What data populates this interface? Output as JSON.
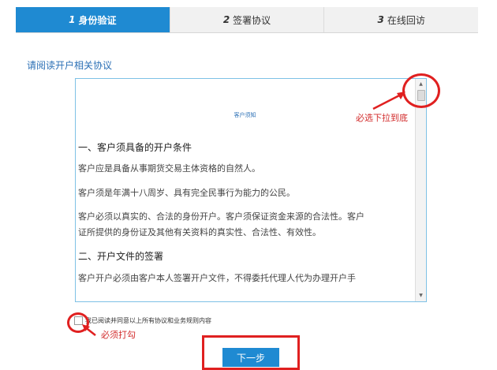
{
  "steps": [
    {
      "num": "1",
      "label": "身份验证",
      "active": true
    },
    {
      "num": "2",
      "label": "签署协议",
      "active": false
    },
    {
      "num": "3",
      "label": "在线回访",
      "active": false
    }
  ],
  "section_title": "请阅读开户相关协议",
  "agreement": {
    "doc_title": "客户须知",
    "heading1": "一、客户须具备的开户条件",
    "para1": "客户应是具备从事期货交易主体资格的自然人。",
    "para2": "客户须是年满十八周岁、具有完全民事行为能力的公民。",
    "para3_line1": "客户必须以真实的、合法的身份开户。客户须保证资金来源的合法性。客户",
    "para3_line2": "证所提供的身份证及其他有关资料的真实性、合法性、有效性。",
    "heading2": "二、开户文件的签署",
    "para4": "客户开户必须由客户本人签署开户文件，不得委托代理人代为办理开户手"
  },
  "annotations": {
    "scroll_hint": "必选下拉到底",
    "check_hint": "必须打勾"
  },
  "agree_text": "我已阅读并同意以上所有协议和业务规则内容",
  "next_label": "下一步",
  "colors": {
    "accent": "#1f8ad2",
    "annotation": "#e02020"
  }
}
